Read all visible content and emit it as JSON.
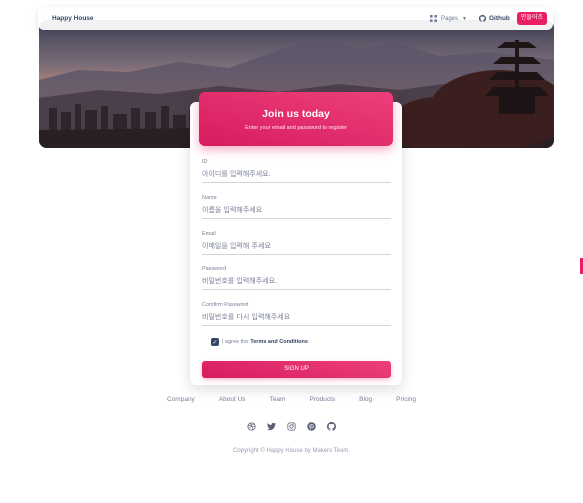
{
  "navbar": {
    "brand": "Happy House",
    "pages_label": "Pages",
    "github_label": "Github",
    "button_label": "만들어조"
  },
  "signup": {
    "title": "Join us today",
    "subtitle": "Enter your email and password to register",
    "fields": [
      {
        "label": "ID",
        "placeholder": "아이디를 입력해주세요."
      },
      {
        "label": "Name",
        "placeholder": "이름을 입력해주세요"
      },
      {
        "label": "Email",
        "placeholder": "이메일을 입력해 주세요"
      },
      {
        "label": "Password",
        "placeholder": "비밀번호를 입력해주세요."
      },
      {
        "label": "Comfirm Password",
        "placeholder": "비밀번호를 다시 입력해주세요"
      }
    ],
    "agree_text": "I agree the",
    "terms_label": "Terms and Conditions",
    "button_label": "SIGN UP"
  },
  "footer": {
    "links": [
      "Company",
      "About Us",
      "Team",
      "Products",
      "Blog",
      "Pricing"
    ],
    "social_icons": [
      "dribbble-icon",
      "twitter-icon",
      "instagram-icon",
      "pinterest-icon",
      "github-icon"
    ],
    "copyright": "Copyright © Happy House by Makers Team."
  },
  "colors": {
    "primary": "#e91e63",
    "dark": "#344767",
    "muted": "#7b809a"
  }
}
